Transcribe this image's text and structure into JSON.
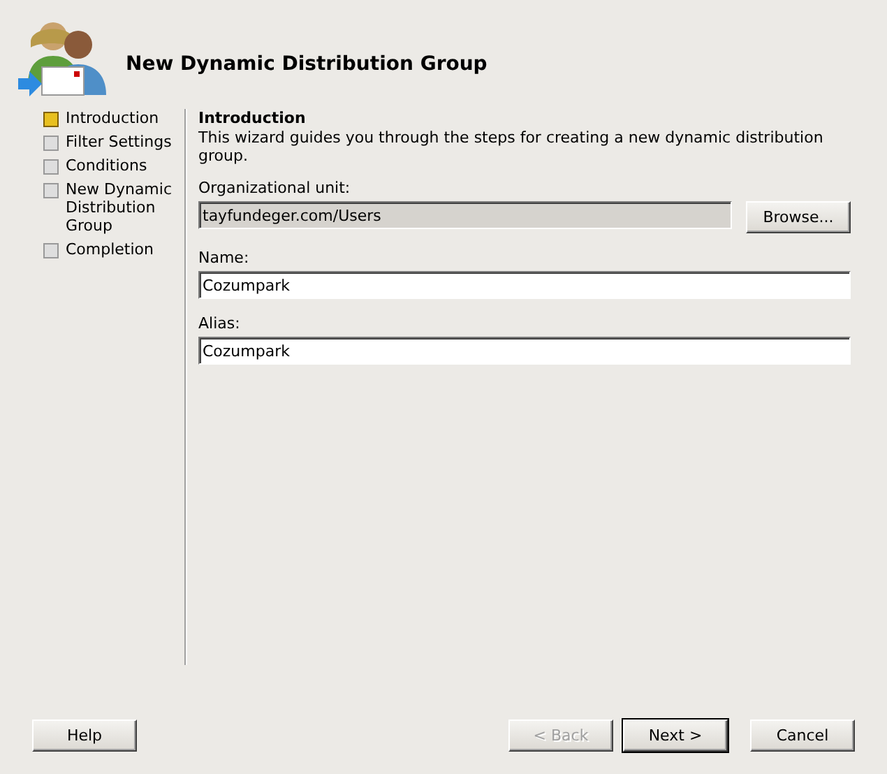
{
  "window": {
    "title": "New Dynamic Distribution Group"
  },
  "steps": [
    {
      "label": "Introduction",
      "selected": true
    },
    {
      "label": "Filter Settings",
      "selected": false
    },
    {
      "label": "Conditions",
      "selected": false
    },
    {
      "label": "New Dynamic Distribution Group",
      "selected": false
    },
    {
      "label": "Completion",
      "selected": false
    }
  ],
  "page": {
    "heading": "Introduction",
    "description": "This wizard guides you through the steps for creating a new dynamic distribution group.",
    "fields": [
      {
        "label": "Organizational unit:",
        "value": "tayfundeger.com/Users",
        "disabled": true,
        "button": "Browse..."
      },
      {
        "label": "Name:",
        "value": "Cozumpark",
        "disabled": false
      },
      {
        "label": "Alias:",
        "value": "Cozumpark",
        "disabled": false
      }
    ]
  },
  "buttons": [
    {
      "label": "Help",
      "disabled": false,
      "default": false
    },
    {
      "label": "< Back",
      "disabled": true,
      "default": false
    },
    {
      "label": "Next >",
      "disabled": false,
      "default": true
    },
    {
      "label": "Cancel",
      "disabled": false,
      "default": false
    }
  ]
}
